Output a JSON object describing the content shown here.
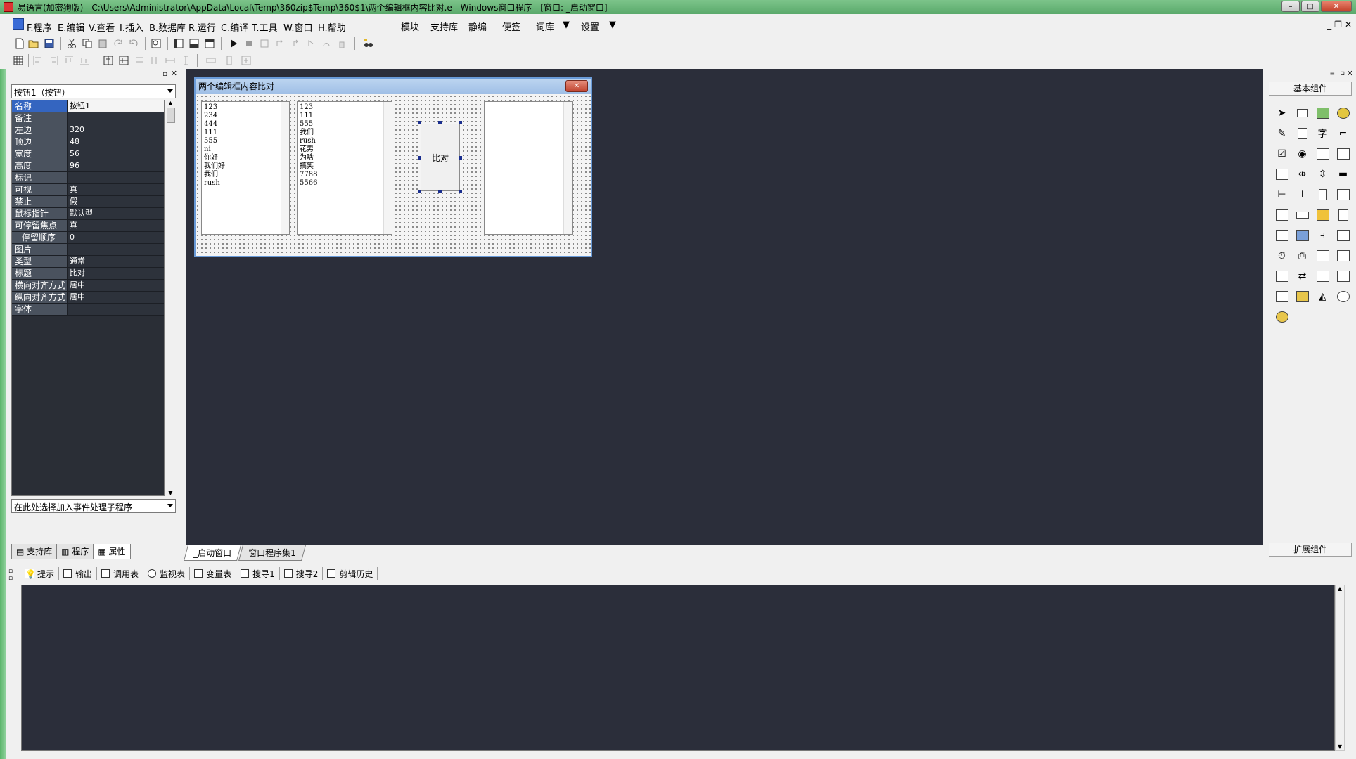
{
  "window": {
    "title": "易语言(加密狗版) - C:\\Users\\Administrator\\AppData\\Local\\Temp\\360zip$Temp\\360$1\\两个编辑框内容比对.e - Windows窗口程序 - [窗口: _启动窗口]",
    "minimize": "–",
    "maximize": "□",
    "close": "✕"
  },
  "menu": {
    "items": [
      "F.程序",
      "E.编辑",
      "V.查看",
      "I.插入",
      "B.数据库",
      "R.运行",
      "C.编译",
      "T.工具",
      "W.窗口",
      "H.帮助"
    ],
    "extra": [
      "模块",
      "支持库",
      "静编",
      "便签",
      "词库",
      "设置"
    ],
    "mdi_min": "_",
    "mdi_restore": "❐",
    "mdi_close": "✕"
  },
  "left_panel": {
    "object_combo": "按钮1（按钮）",
    "properties": [
      {
        "name": "名称",
        "value": "按钮1"
      },
      {
        "name": "备注",
        "value": ""
      },
      {
        "name": "左边",
        "value": "320"
      },
      {
        "name": "顶边",
        "value": "48"
      },
      {
        "name": "宽度",
        "value": "56"
      },
      {
        "name": "高度",
        "value": "96"
      },
      {
        "name": "标记",
        "value": ""
      },
      {
        "name": "可视",
        "value": "真"
      },
      {
        "name": "禁止",
        "value": "假"
      },
      {
        "name": "鼠标指针",
        "value": "默认型"
      },
      {
        "name": "可停留焦点",
        "value": "真"
      },
      {
        "name": "停留顺序",
        "value": "0"
      },
      {
        "name": "图片",
        "value": ""
      },
      {
        "name": "类型",
        "value": "通常"
      },
      {
        "name": "标题",
        "value": "比对"
      },
      {
        "name": "横向对齐方式",
        "value": "居中"
      },
      {
        "name": "纵向对齐方式",
        "value": "居中"
      },
      {
        "name": "字体",
        "value": ""
      }
    ],
    "event_combo": "在此处选择加入事件处理子程序",
    "tabs": [
      "支持库",
      "程序",
      "属性"
    ]
  },
  "design": {
    "form_title": "两个编辑框内容比对",
    "form_close": "✕",
    "edit1_lines": [
      "123",
      "234",
      "444",
      "111",
      "555",
      "ni",
      "你好",
      "我们好",
      "我们",
      "rush"
    ],
    "edit2_lines": [
      "123",
      "111",
      "555",
      "我们",
      "rush",
      "花男",
      "为啥",
      "搞笑",
      "7788",
      "5566"
    ],
    "button_label": "比对",
    "tabs": [
      "_启动窗口",
      "窗口程序集1"
    ]
  },
  "right_panel": {
    "header": "基本组件",
    "footer": "扩展组件",
    "glyph_text": "字"
  },
  "output": {
    "tabs": [
      "提示",
      "输出",
      "调用表",
      "监视表",
      "变量表",
      "搜寻1",
      "搜寻2",
      "剪辑历史"
    ]
  }
}
